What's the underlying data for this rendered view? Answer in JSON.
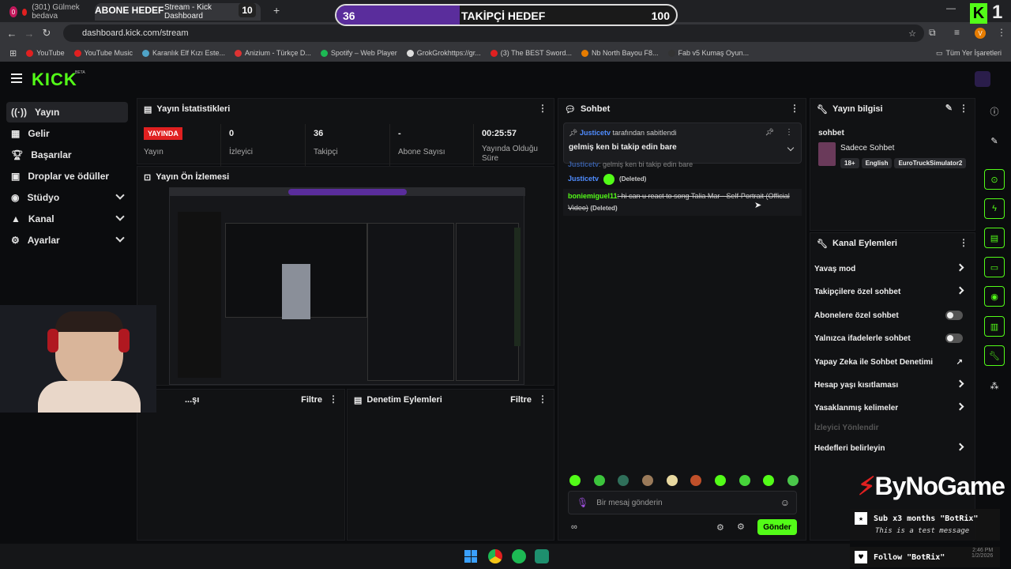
{
  "browser": {
    "tabs": [
      {
        "badge": "0",
        "title": "(301) Gülmek bedava"
      },
      {
        "title": "Stream - Kick Dashboard"
      }
    ],
    "url": "dashboard.kick.com/stream",
    "bookmarks": [
      "YouTube",
      "YouTube Music",
      "Karanlık Elf Kızı Este...",
      "Anizium - Türkçe D...",
      "Spotify – Web Player",
      "GrokGrokhttps://gr...",
      "(3) The BEST Sword...",
      "Nb North Bayou F8...",
      "Fab v5 Kumaş Oyun..."
    ],
    "bookmarks_right": "Tüm Yer İşaretleri",
    "profile_initial": "V"
  },
  "overlay": {
    "abone_label": "ABONE HEDEF",
    "abone_target": "10",
    "takipci_current": "36",
    "takipci_label": "TAKİPÇİ HEDEF",
    "takipci_target": "100",
    "corner_number": "1",
    "brand": "ByNoGame",
    "alert1": "Sub x3 months \"BotRix\"",
    "alert1_sub": "This is a test message",
    "alert2": "Follow \"BotRix\""
  },
  "header": {
    "logo": "KICK",
    "logo_sup": "BETA"
  },
  "sidebar": {
    "items": [
      {
        "label": "Yayın",
        "icon": "broadcast-icon"
      },
      {
        "label": "Gelir",
        "icon": "revenue-icon"
      },
      {
        "label": "Başarılar",
        "icon": "trophy-icon"
      },
      {
        "label": "Droplar ve ödüller",
        "icon": "drops-icon"
      },
      {
        "label": "Stüdyo",
        "icon": "studio-icon"
      },
      {
        "label": "Kanal",
        "icon": "channel-icon"
      },
      {
        "label": "Ayarlar",
        "icon": "gear-icon"
      }
    ]
  },
  "stats": {
    "title": "Yayın İstatistikleri",
    "live_badge": "YAYINDA",
    "cells": [
      {
        "value": "",
        "label": "Yayın"
      },
      {
        "value": "0",
        "label": "İzleyici"
      },
      {
        "value": "36",
        "label": "Takipçi"
      },
      {
        "value": "-",
        "label": "Abone Sayısı"
      },
      {
        "value": "00:25:57",
        "label": "Yayında Olduğu Süre"
      }
    ]
  },
  "preview": {
    "title": "Yayın Ön İzlemesi"
  },
  "bottom_panels": {
    "left_title": "...şı",
    "left_filter": "Filtre",
    "right_title": "Denetim Eylemleri",
    "right_filter": "Filtre"
  },
  "chat": {
    "title": "Sohbet",
    "pinned_user": "Justicetv",
    "pinned_by": "tarafından sabitlendi",
    "pinned_text": "gelmiş ken bi takip edin bare",
    "msg0_user": "Justicetv",
    "msg0_text": ": gelmiş ken bi takip edin bare",
    "msg1_user": "Justicetv",
    "msg1_deleted": "(Deleted)",
    "msg2_user": "boniemiguel11",
    "msg2_text": ": hi can u react to song Talia Mar - Self-Portrait (Official Video)",
    "msg2_deleted": "(Deleted)",
    "input_placeholder": "Bir mesaj gönderin",
    "send_label": "Gönder"
  },
  "stream_info": {
    "title": "Yayın bilgisi",
    "stream_title": "sohbet",
    "category": "Sadece Sohbet",
    "tags": [
      "18+",
      "English",
      "EuroTruckSimulator2"
    ]
  },
  "channel_actions": {
    "title": "Kanal Eylemleri",
    "rows": [
      {
        "label": "Yavaş mod",
        "control": "chevron"
      },
      {
        "label": "Takipçilere özel sohbet",
        "control": "chevron"
      },
      {
        "label": "Abonelere özel sohbet",
        "control": "toggle"
      },
      {
        "label": "Yalnızca ifadelerle sohbet",
        "control": "toggle"
      },
      {
        "label": "Yapay Zeka ile Sohbet Denetimi",
        "control": "external"
      },
      {
        "label": "Hesap yaşı kısıtlaması",
        "control": "chevron"
      },
      {
        "label": "Yasaklanmış kelimeler",
        "control": "chevron"
      },
      {
        "label": "İzleyici Yönlendir",
        "control": "disabled"
      },
      {
        "label": "Hedefleri belirleyin",
        "control": "chevron"
      }
    ]
  },
  "taskbar": {
    "clock": "2:46 PM",
    "date": "1/2/2026"
  },
  "colors": {
    "kick_green": "#53fc18",
    "live_red": "#e02020",
    "goal_purple": "#5a2d9c"
  }
}
